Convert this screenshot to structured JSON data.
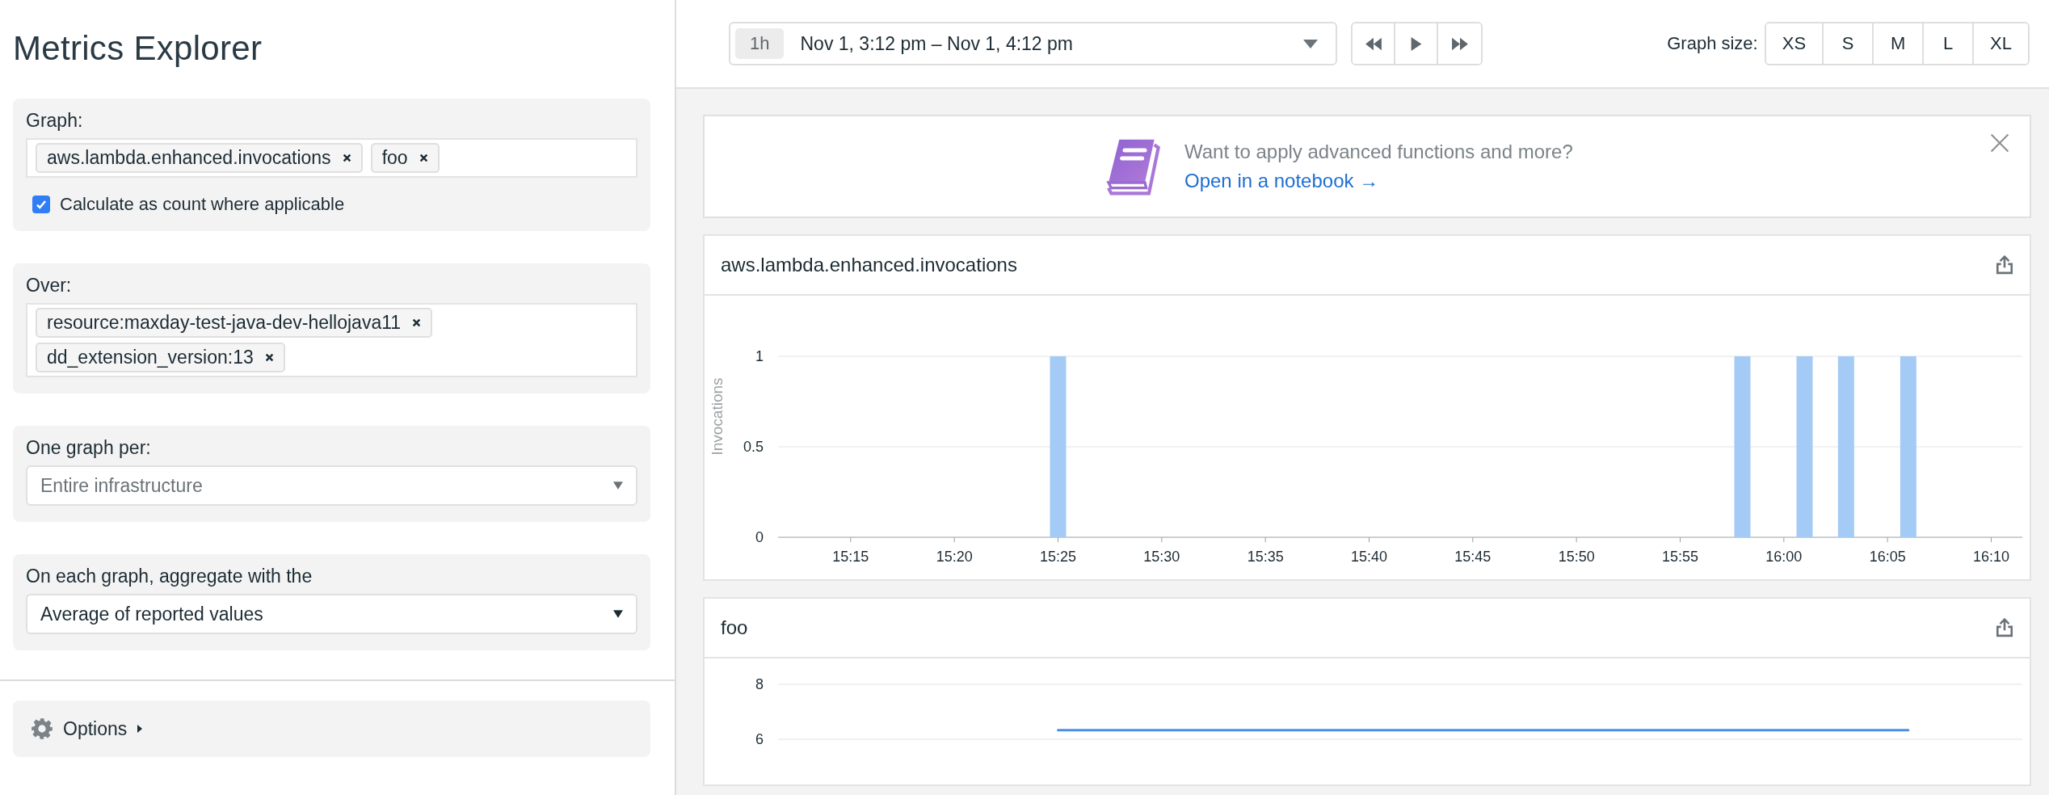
{
  "sidebar": {
    "title": "Metrics Explorer",
    "graph": {
      "label": "Graph:",
      "tags": [
        "aws.lambda.enhanced.invocations",
        "foo"
      ],
      "checkbox": {
        "label": "Calculate as count where applicable",
        "checked": true
      }
    },
    "over": {
      "label": "Over:",
      "tags": [
        "resource:maxday-test-java-dev-hellojava11",
        "dd_extension_version:13"
      ]
    },
    "one_graph_per": {
      "label": "One graph per:",
      "placeholder": "Entire infrastructure"
    },
    "aggregate": {
      "label": "On each graph, aggregate with the",
      "value": "Average of reported values"
    },
    "options": {
      "label": "Options",
      "expanded": false
    }
  },
  "toolbar": {
    "time_range": {
      "badge": "1h",
      "label": "Nov 1, 3:12 pm – Nov 1, 4:12 pm"
    },
    "graph_size": {
      "label": "Graph size:",
      "sizes": [
        {
          "label": "XS",
          "selected": false
        },
        {
          "label": "S",
          "selected": false
        },
        {
          "label": "M",
          "selected": false
        },
        {
          "label": "L",
          "selected": false
        },
        {
          "label": "XL",
          "selected": false
        }
      ]
    }
  },
  "banner": {
    "text": "Want to apply advanced functions and more?",
    "link": "Open in a notebook →"
  },
  "graphs": [
    {
      "title": "aws.lambda.enhanced.invocations",
      "chart_data": {
        "type": "bar",
        "ylabel": "Invocations",
        "ylim": [
          0,
          1
        ],
        "yticks": [
          0,
          0.5,
          1
        ],
        "categories": [
          null,
          null,
          null,
          "15:15",
          null,
          null,
          null,
          null,
          "15:20",
          null,
          null,
          null,
          null,
          "15:25",
          null,
          null,
          null,
          null,
          "15:30",
          null,
          null,
          null,
          null,
          "15:35",
          null,
          null,
          null,
          null,
          "15:40",
          null,
          null,
          null,
          null,
          "15:45",
          null,
          null,
          null,
          null,
          "15:50",
          null,
          null,
          null,
          null,
          "15:55",
          null,
          null,
          null,
          null,
          "16:00",
          null,
          null,
          null,
          null,
          "16:05",
          null,
          null,
          null,
          null,
          "16:10",
          null
        ],
        "values": [
          null,
          null,
          null,
          null,
          null,
          null,
          null,
          null,
          null,
          null,
          null,
          null,
          null,
          1,
          null,
          null,
          null,
          null,
          null,
          null,
          null,
          null,
          null,
          null,
          null,
          null,
          null,
          null,
          null,
          null,
          null,
          null,
          null,
          null,
          null,
          null,
          null,
          null,
          null,
          null,
          null,
          null,
          null,
          null,
          null,
          null,
          1,
          null,
          null,
          1,
          null,
          1,
          null,
          null,
          1,
          null,
          null,
          null,
          null,
          null
        ]
      }
    },
    {
      "title": "foo",
      "chart_data": {
        "type": "line",
        "ylim": [
          6,
          8
        ],
        "yticks": [
          6,
          8
        ],
        "categories": [
          null,
          null,
          null,
          null,
          null,
          null,
          null,
          null,
          null,
          null,
          null,
          null,
          null,
          null,
          null,
          null,
          null,
          null,
          null,
          null,
          null,
          null,
          null,
          null,
          null,
          null,
          null,
          null,
          null,
          null,
          null,
          null,
          null,
          null,
          null,
          null,
          null,
          null,
          null,
          null,
          null,
          null,
          null,
          null,
          null,
          null,
          null,
          null,
          null,
          null,
          null,
          null,
          null,
          null,
          null,
          null,
          null,
          null,
          null,
          null
        ],
        "values": [
          null,
          null,
          null,
          null,
          null,
          null,
          null,
          null,
          null,
          null,
          null,
          null,
          null,
          6.33,
          6.33,
          6.33,
          6.33,
          6.33,
          6.33,
          6.33,
          6.33,
          6.33,
          6.33,
          6.33,
          6.33,
          6.33,
          6.33,
          6.33,
          6.33,
          6.33,
          6.33,
          6.33,
          6.33,
          6.33,
          6.33,
          6.33,
          6.33,
          6.33,
          6.33,
          6.33,
          6.33,
          6.33,
          6.33,
          6.33,
          6.33,
          6.33,
          6.33,
          6.33,
          6.33,
          6.33,
          6.33,
          6.33,
          6.33,
          6.33,
          6.33,
          null,
          null,
          null,
          null,
          null
        ]
      }
    }
  ]
}
